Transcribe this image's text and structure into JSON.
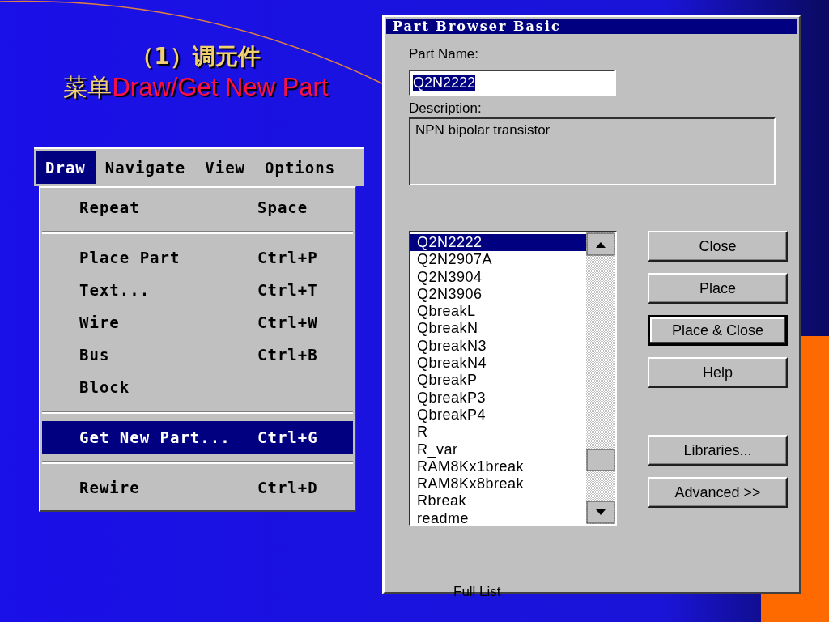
{
  "slide": {
    "heading": "（1）调元件",
    "subheading_prefix": "菜单",
    "subheading_highlight": "Draw/Get New Part"
  },
  "menu_bar": [
    {
      "label": "Draw",
      "selected": true
    },
    {
      "label": "Navigate",
      "selected": false
    },
    {
      "label": "View",
      "selected": false
    },
    {
      "label": "Options",
      "selected": false
    }
  ],
  "draw_menu": [
    {
      "kind": "item",
      "label": "Repeat",
      "shortcut": "Space",
      "selected": false
    },
    {
      "kind": "separator"
    },
    {
      "kind": "item",
      "label": "Place Part",
      "shortcut": "Ctrl+P",
      "selected": false
    },
    {
      "kind": "item",
      "label": "Text...",
      "shortcut": "Ctrl+T",
      "selected": false
    },
    {
      "kind": "item",
      "label": "Wire",
      "shortcut": "Ctrl+W",
      "selected": false
    },
    {
      "kind": "item",
      "label": "Bus",
      "shortcut": "Ctrl+B",
      "selected": false
    },
    {
      "kind": "item",
      "label": "Block",
      "selected": false
    },
    {
      "kind": "separator"
    },
    {
      "kind": "item",
      "label": "Get New Part...",
      "shortcut": "Ctrl+G",
      "selected": true
    },
    {
      "kind": "separator"
    },
    {
      "kind": "item",
      "label": "Rewire",
      "shortcut": "Ctrl+D",
      "selected": false
    }
  ],
  "dialog": {
    "title": "Part Browser Basic",
    "part_name_label": "Part Name:",
    "part_name_value": "Q2N2222",
    "description_label": "Description:",
    "description_value": "NPN bipolar transistor",
    "parts": [
      {
        "label": "Q2N2222",
        "selected": true
      },
      {
        "label": "Q2N2907A",
        "selected": false
      },
      {
        "label": "Q2N3904",
        "selected": false
      },
      {
        "label": "Q2N3906",
        "selected": false
      },
      {
        "label": "QbreakL",
        "selected": false
      },
      {
        "label": "QbreakN",
        "selected": false
      },
      {
        "label": "QbreakN3",
        "selected": false
      },
      {
        "label": "QbreakN4",
        "selected": false
      },
      {
        "label": "QbreakP",
        "selected": false
      },
      {
        "label": "QbreakP3",
        "selected": false
      },
      {
        "label": "QbreakP4",
        "selected": false
      },
      {
        "label": "R",
        "selected": false
      },
      {
        "label": "R_var",
        "selected": false
      },
      {
        "label": "RAM8Kx1break",
        "selected": false
      },
      {
        "label": "RAM8Kx8break",
        "selected": false
      },
      {
        "label": "Rbreak",
        "selected": false
      },
      {
        "label": "readme",
        "selected": false
      }
    ],
    "button_groups": [
      [
        {
          "label": "Close",
          "default": false
        },
        {
          "label": "Place",
          "default": false
        },
        {
          "label": "Place & Close",
          "default": true
        },
        {
          "label": "Help",
          "default": false
        }
      ],
      [
        {
          "label": "Libraries...",
          "default": false
        },
        {
          "label": "Advanced >>",
          "default": false
        }
      ]
    ],
    "footer": "Full List"
  }
}
